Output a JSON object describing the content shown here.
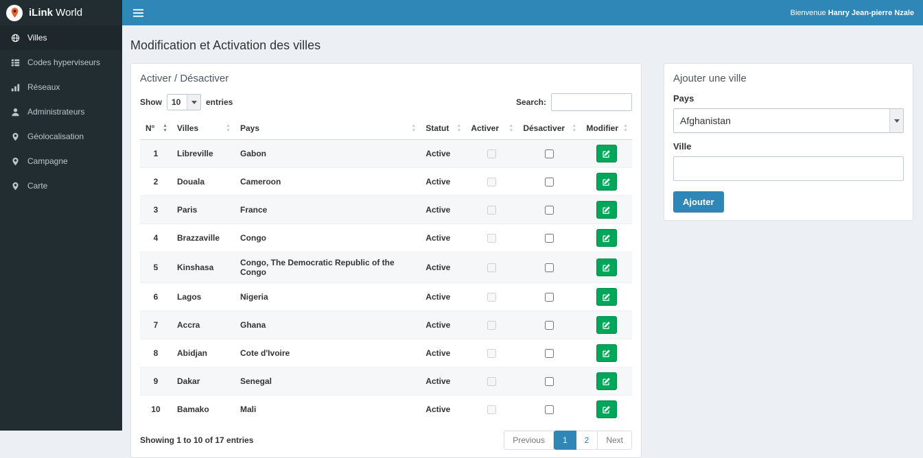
{
  "colors": {
    "header_blue": "#2f87b8",
    "sidebar_dark": "#222d32",
    "success_green": "#00a65a",
    "logo_orange": "#e8642c"
  },
  "header": {
    "brand_bold": "iLink",
    "brand_rest": " World",
    "welcome_prefix": "Bienvenue ",
    "welcome_name": "Hanry Jean-pierre Nzale"
  },
  "sidebar": {
    "items": [
      {
        "label": "Villes",
        "icon": "globe-icon",
        "active": true
      },
      {
        "label": "Codes hyperviseurs",
        "icon": "list-icon",
        "active": false
      },
      {
        "label": "Réseaux",
        "icon": "bar-chart-icon",
        "active": false
      },
      {
        "label": "Administrateurs",
        "icon": "user-icon",
        "active": false
      },
      {
        "label": "Géolocalisation",
        "icon": "map-marker-icon",
        "active": false
      },
      {
        "label": "Campagne",
        "icon": "map-marker-icon",
        "active": false
      },
      {
        "label": "Carte",
        "icon": "map-marker-icon",
        "active": false
      }
    ]
  },
  "page": {
    "title": "Modification et Activation des villes"
  },
  "table_panel": {
    "title": "Activer / Désactiver",
    "show_label": "Show",
    "entries_label": "entries",
    "page_length": "10",
    "search_label": "Search:",
    "search_value": "",
    "columns": [
      "N°",
      "Villes",
      "Pays",
      "Statut",
      "Activer",
      "Désactiver",
      "Modifier"
    ],
    "rows": [
      {
        "num": "1",
        "ville": "Libreville",
        "pays": "Gabon",
        "statut": "Active"
      },
      {
        "num": "2",
        "ville": "Douala",
        "pays": "Cameroon",
        "statut": "Active"
      },
      {
        "num": "3",
        "ville": "Paris",
        "pays": "France",
        "statut": "Active"
      },
      {
        "num": "4",
        "ville": "Brazzaville",
        "pays": "Congo",
        "statut": "Active"
      },
      {
        "num": "5",
        "ville": "Kinshasa",
        "pays": "Congo, The Democratic Republic of the Congo",
        "statut": "Active"
      },
      {
        "num": "6",
        "ville": "Lagos",
        "pays": "Nigeria",
        "statut": "Active"
      },
      {
        "num": "7",
        "ville": "Accra",
        "pays": "Ghana",
        "statut": "Active"
      },
      {
        "num": "8",
        "ville": "Abidjan",
        "pays": "Cote d'Ivoire",
        "statut": "Active"
      },
      {
        "num": "9",
        "ville": "Dakar",
        "pays": "Senegal",
        "statut": "Active"
      },
      {
        "num": "10",
        "ville": "Bamako",
        "pays": "Mali",
        "statut": "Active"
      }
    ],
    "footer": {
      "info": "Showing 1 to 10 of 17 entries",
      "previous_label": "Previous",
      "pages": [
        {
          "label": "1",
          "active": true
        },
        {
          "label": "2",
          "active": false
        }
      ],
      "next_label": "Next"
    }
  },
  "add_panel": {
    "title": "Ajouter une ville",
    "pays_label": "Pays",
    "pays_value": "Afghanistan",
    "ville_label": "Ville",
    "ville_value": "",
    "submit_label": "Ajouter"
  }
}
